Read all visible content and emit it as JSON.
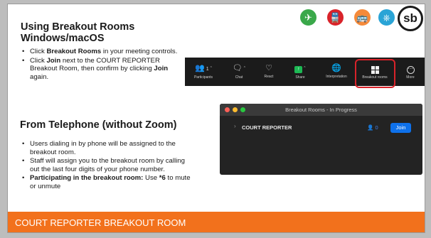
{
  "slide": {
    "section1_title": "Using Breakout Rooms Windows/macOS",
    "section1_bullets": [
      [
        {
          "text": "Click ",
          "bold": false
        },
        {
          "text": "Breakout Rooms",
          "bold": true
        },
        {
          "text": " in your meeting controls.",
          "bold": false
        }
      ],
      [
        {
          "text": "Click ",
          "bold": false
        },
        {
          "text": "Join",
          "bold": true
        },
        {
          "text": " next to the COURT REPORTER Breakout Room, then confirm by clicking ",
          "bold": false
        },
        {
          "text": "Join",
          "bold": true
        },
        {
          "text": " again.",
          "bold": false
        }
      ]
    ],
    "section2_title": "From Telephone (without Zoom)",
    "section2_bullets": [
      [
        {
          "text": "Users dialing in by phone will be assigned to the breakout room.",
          "bold": false
        }
      ],
      [
        {
          "text": "Staff will assign you to the breakout room by calling out the last four digits of your phone number.",
          "bold": false
        }
      ],
      [
        {
          "text": "Participating in the breakout room:",
          "bold": true
        },
        {
          "text": " Use ",
          "bold": false
        },
        {
          "text": "*6",
          "bold": true
        },
        {
          "text": " to mute or unmute",
          "bold": false
        }
      ]
    ]
  },
  "toolbar": {
    "participants_glyph": "ᴇ 1 ˄",
    "items": [
      {
        "label": "Participants",
        "icon": "participants-icon"
      },
      {
        "label": "Chat",
        "icon": "chat-icon"
      },
      {
        "label": "React",
        "icon": "heart-icon"
      },
      {
        "label": "Share",
        "icon": "share-icon"
      },
      {
        "label": "Interpretation",
        "icon": "globe-icon"
      },
      {
        "label": "Breakout rooms",
        "icon": "breakout-rooms-icon"
      },
      {
        "label": "More",
        "icon": "more-icon"
      }
    ],
    "highlight_color": "#d9232a"
  },
  "breakout_window": {
    "title": "Breakout Rooms - In Progress",
    "room_name": "COURT REPORTER",
    "participant_count": "0",
    "join_label": "Join"
  },
  "footer": {
    "title": "COURT REPORTER BREAKOUT ROOM",
    "logo_text": "sb",
    "bar_color": "#f2711c"
  }
}
